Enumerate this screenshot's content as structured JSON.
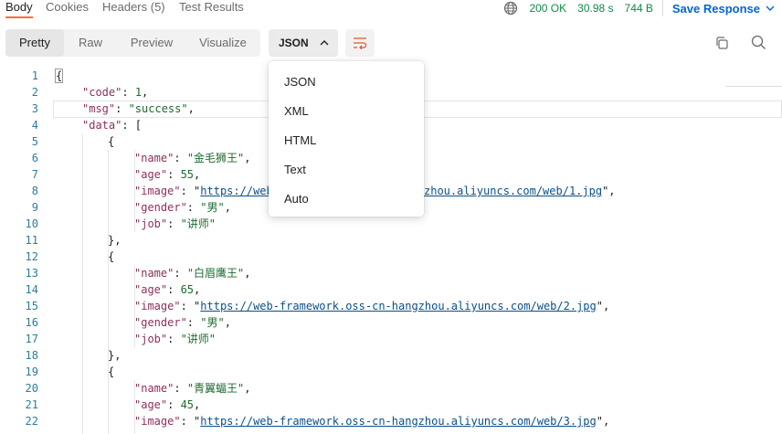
{
  "tabs": [
    "Body",
    "Cookies",
    "Headers (5)",
    "Test Results"
  ],
  "status": {
    "code": "200 OK",
    "time": "30.98 s",
    "size": "744 B",
    "save_label": "Save Response"
  },
  "view_modes": [
    "Pretty",
    "Raw",
    "Preview",
    "Visualize"
  ],
  "format": {
    "selected": "JSON",
    "options": [
      "JSON",
      "XML",
      "HTML",
      "Text",
      "Auto"
    ]
  },
  "line_numbers": [
    "1",
    "2",
    "3",
    "4",
    "5",
    "6",
    "7",
    "8",
    "9",
    "10",
    "11",
    "12",
    "13",
    "14",
    "15",
    "16",
    "17",
    "18",
    "19",
    "20",
    "21",
    "22"
  ],
  "json": {
    "code_key": "\"code\"",
    "code_val": "1",
    "msg_key": "\"msg\"",
    "msg_val": "\"success\"",
    "data_key": "\"data\"",
    "name_key": "\"name\"",
    "age_key": "\"age\"",
    "image_key": "\"image\"",
    "gender_key": "\"gender\"",
    "job_key": "\"job\"",
    "items": [
      {
        "name": "\"金毛狮王\"",
        "age": "55",
        "image_a": "https://web",
        "image_b": "zhou.aliyuncs.com/web/1.jpg",
        "gender": "\"男\"",
        "job": "\"讲师\""
      },
      {
        "name": "\"白眉鹰王\"",
        "age": "65",
        "image": "https://web-framework.oss-cn-hangzhou.aliyuncs.com/web/2.jpg",
        "gender": "\"男\"",
        "job": "\"讲师\""
      },
      {
        "name": "\"青翼蝠王\"",
        "age": "45",
        "image": "https://web-framework.oss-cn-hangzhou.aliyuncs.com/web/3.jpg"
      }
    ]
  }
}
